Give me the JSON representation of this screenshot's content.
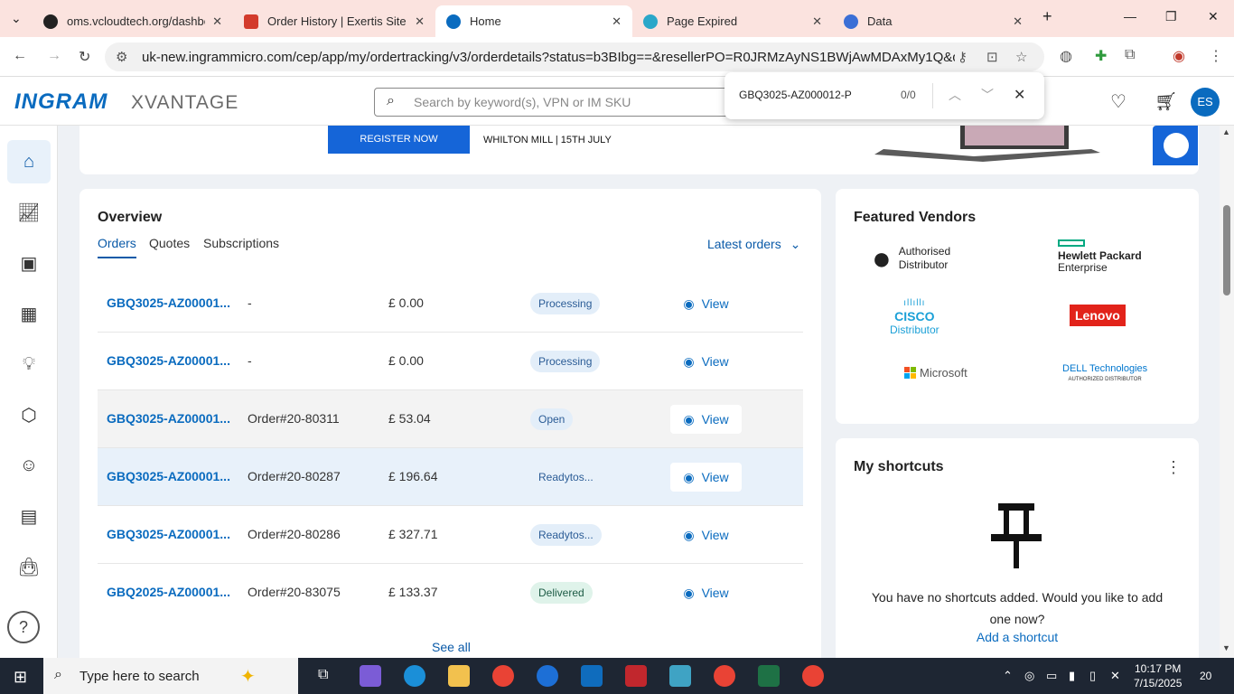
{
  "browser": {
    "tabs": [
      {
        "title": "oms.vcloudtech.org/dashbo...",
        "favicon_color": "#222222"
      },
      {
        "title": "Order History | Exertis Site",
        "favicon_color": "#d33b2c"
      },
      {
        "title": "Home",
        "favicon_color": "#0a6bbf"
      },
      {
        "title": "Page Expired",
        "favicon_color": "#2aa7c9"
      },
      {
        "title": "Data",
        "favicon_color": "#3b6fd6"
      }
    ],
    "url": "uk-new.ingrammicro.com/cep/app/my/ordertracking/v3/orderdetails?status=b3BIbg==&resellerPO=R0JRMzAyNS1BWjAwMDAxMy1Q&order..."
  },
  "find_bar": {
    "query": "GBQ3025-AZ000012-P",
    "count": "0/0"
  },
  "header": {
    "logo_primary": "INGRAM",
    "logo_secondary": "XVANTAGE",
    "search_placeholder": "Search by keyword(s), VPN or IM SKU",
    "avatar_initials": "ES"
  },
  "banner": {
    "register_label": "REGISTER NOW",
    "event_text": "WHILTON MILL | 15TH JULY"
  },
  "overview": {
    "title": "Overview",
    "tabs": [
      "Orders",
      "Quotes",
      "Subscriptions"
    ],
    "filter_label": "Latest orders",
    "rows": [
      {
        "id": "GBQ3025-AZ00001...",
        "po": "-",
        "amount": "£ 0.00",
        "status": "Processing",
        "view": "View"
      },
      {
        "id": "GBQ3025-AZ00001...",
        "po": "-",
        "amount": "£ 0.00",
        "status": "Processing",
        "view": "View"
      },
      {
        "id": "GBQ3025-AZ00001...",
        "po": "Order#20-80311",
        "amount": "£ 53.04",
        "status": "Open",
        "view": "View"
      },
      {
        "id": "GBQ3025-AZ00001...",
        "po": "Order#20-80287",
        "amount": "£ 196.64",
        "status": "Readytos...",
        "view": "View"
      },
      {
        "id": "GBQ3025-AZ00001...",
        "po": "Order#20-80286",
        "amount": "£ 327.71",
        "status": "Readytos...",
        "view": "View"
      },
      {
        "id": "GBQ2025-AZ00001...",
        "po": "Order#20-83075",
        "amount": "£ 133.37",
        "status": "Delivered",
        "view": "View"
      }
    ],
    "see_all": "See all"
  },
  "featured_vendors": {
    "title": "Featured Vendors",
    "vendors": [
      {
        "line1": "Authorised",
        "line2": "Distributor"
      },
      {
        "line1": "Hewlett Packard",
        "line2": "Enterprise"
      },
      {
        "line1": "CISCO",
        "line2": "Distributor"
      },
      {
        "line1": "Lenovo",
        "line2": ""
      },
      {
        "line1": "Microsoft",
        "line2": ""
      },
      {
        "line1": "DELL Technologies",
        "line2": "AUTHORIZED DISTRIBUTOR"
      }
    ]
  },
  "shortcuts": {
    "title": "My shortcuts",
    "message": "You have no shortcuts added. Would you like to add one now?",
    "add_label": "Add a shortcut"
  },
  "taskbar": {
    "search_text": "Type here to search",
    "time": "10:17 PM",
    "date": "7/15/2025",
    "notifications": "20"
  }
}
